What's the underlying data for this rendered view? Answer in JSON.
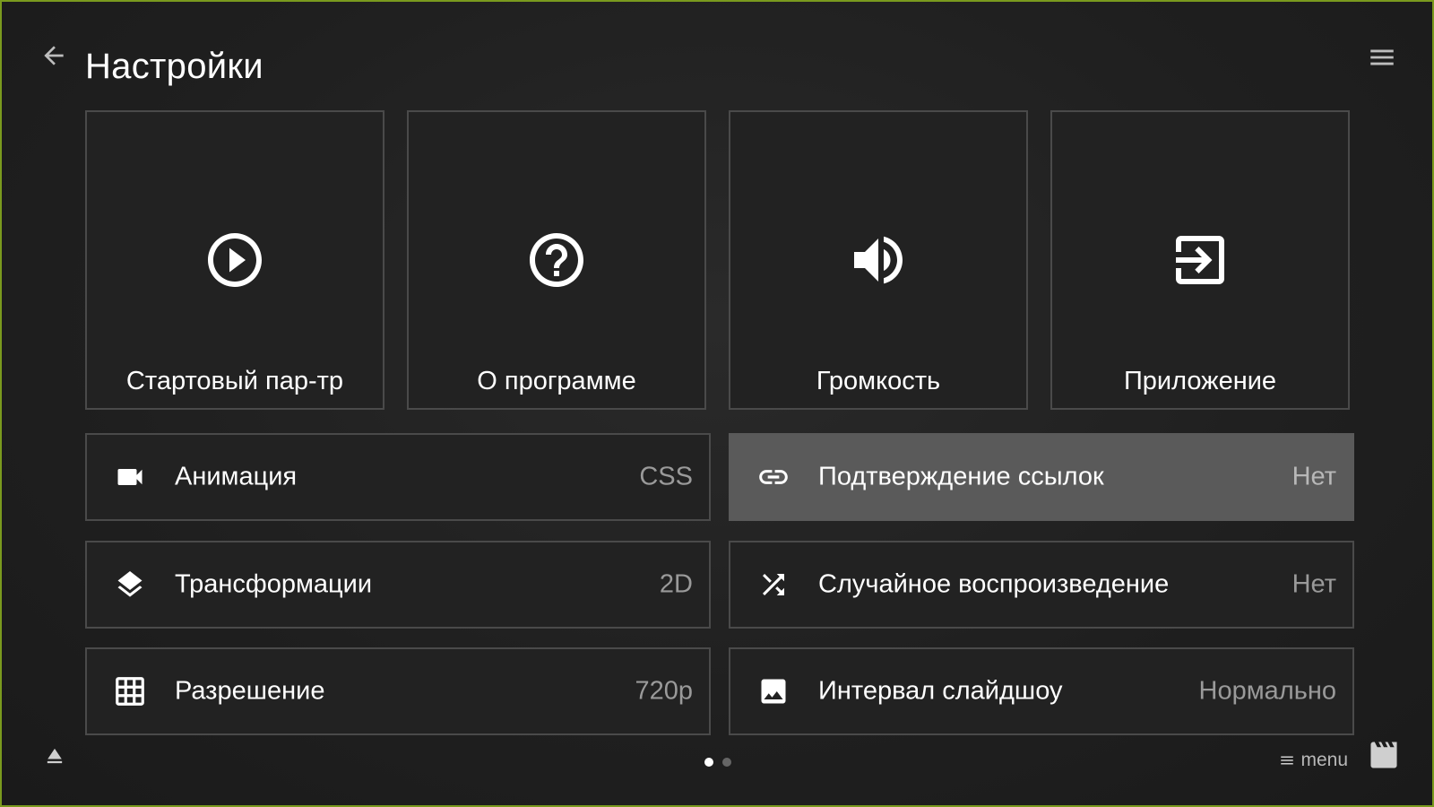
{
  "header": {
    "title": "Настройки",
    "back_icon": "arrow-left-icon",
    "menu_icon": "hamburger-icon"
  },
  "tiles": [
    {
      "label": "Стартовый пар-тр",
      "icon": "play-circle-icon"
    },
    {
      "label": "О программе",
      "icon": "help-circle-icon"
    },
    {
      "label": "Громкость",
      "icon": "volume-icon"
    },
    {
      "label": "Приложение",
      "icon": "exit-icon"
    }
  ],
  "settings": [
    {
      "label": "Анимация",
      "value": "CSS",
      "icon": "video-camera-icon"
    },
    {
      "label": "Подтверждение ссылок",
      "value": "Нет",
      "icon": "link-icon",
      "selected": true
    },
    {
      "label": "Трансформации",
      "value": "2D",
      "icon": "layers-icon"
    },
    {
      "label": "Случайное воспроизведение",
      "value": "Нет",
      "icon": "shuffle-icon"
    },
    {
      "label": "Разрешение",
      "value": "720p",
      "icon": "grid-icon"
    },
    {
      "label": "Интервал слайдшоу",
      "value": "Нормально",
      "icon": "image-icon"
    }
  ],
  "footer": {
    "menu_hint": "menu",
    "eject_icon": "eject-icon",
    "clapper_icon": "clapperboard-icon",
    "page_count": 2,
    "current_page": 1
  },
  "colors": {
    "frame_border": "#7a9a1e",
    "background": "#1c1c1c",
    "tile_border": "#4a4a4a",
    "selected_row": "#5a5a5a",
    "value_text": "#9a9a9a"
  }
}
